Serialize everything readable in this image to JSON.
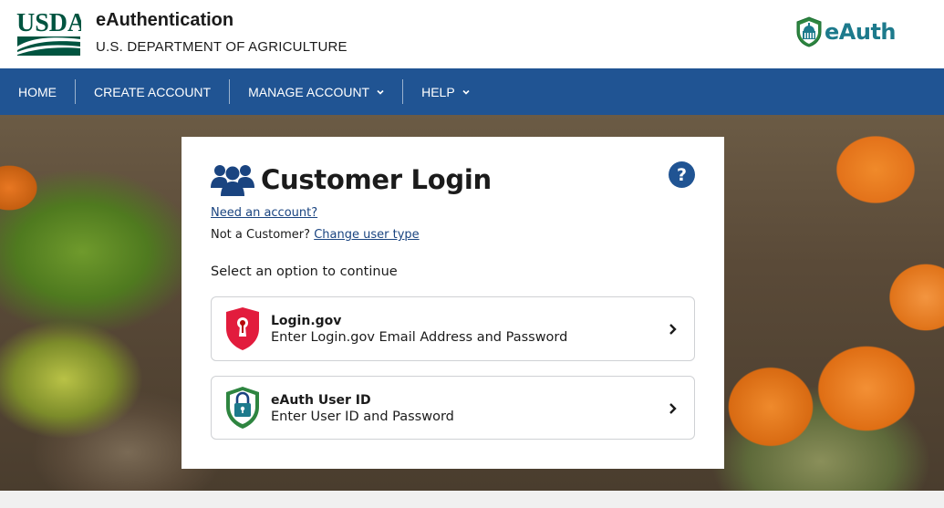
{
  "header": {
    "logo_text": "USDA",
    "title": "eAuthentication",
    "subtitle": "U.S. DEPARTMENT OF AGRICULTURE",
    "brand": "eAuth"
  },
  "nav": {
    "items": [
      {
        "label": "HOME",
        "has_dropdown": false
      },
      {
        "label": "CREATE ACCOUNT",
        "has_dropdown": false
      },
      {
        "label": "MANAGE ACCOUNT",
        "has_dropdown": true
      },
      {
        "label": "HELP",
        "has_dropdown": true
      }
    ]
  },
  "login": {
    "title": "Customer Login",
    "help_label": "?",
    "need_account": "Need an account?",
    "not_customer_prefix": "Not a Customer?",
    "change_user_type": "Change user type",
    "select_prompt": "Select an option to continue",
    "options": [
      {
        "title": "Login.gov",
        "description": "Enter Login.gov Email Address and Password",
        "icon": "login-gov-shield-icon"
      },
      {
        "title": "eAuth User ID",
        "description": "Enter User ID and Password",
        "icon": "eauth-lock-shield-icon"
      }
    ]
  },
  "colors": {
    "nav_bg": "#205493",
    "link": "#1a4480",
    "brand_teal": "#1d7a8c",
    "usda_green": "#005440",
    "login_gov_red": "#e21c3d"
  }
}
